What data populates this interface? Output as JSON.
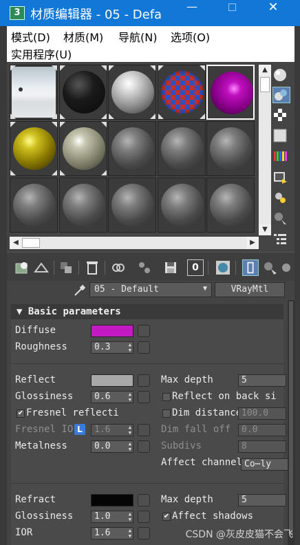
{
  "window": {
    "title": "材质编辑器 - 05 - Defa",
    "app_icon_glyph": "3",
    "min_glyph": "—",
    "close_glyph": "✕"
  },
  "menu": {
    "mode": "模式(D)",
    "material": "材质(M)",
    "navigation": "导航(N)",
    "options": "选项(O)",
    "utilities": "实用程序(U)"
  },
  "slots": [
    {
      "type": "sky"
    },
    {
      "type": "black"
    },
    {
      "type": "white"
    },
    {
      "type": "check"
    },
    {
      "type": "purple",
      "active": true
    },
    {
      "type": "yellow"
    },
    {
      "type": "olive"
    },
    {
      "type": "grey"
    },
    {
      "type": "grey"
    },
    {
      "type": "grey"
    },
    {
      "type": "grey"
    },
    {
      "type": "grey"
    },
    {
      "type": "grey"
    },
    {
      "type": "grey"
    },
    {
      "type": "grey"
    }
  ],
  "material": {
    "name": "05 - Default",
    "type": "VRayMtl"
  },
  "rollout": {
    "title": "Basic parameters",
    "collapse_glyph": "▼"
  },
  "params": {
    "diffuse_label": "Diffuse",
    "diffuse_color": "#c31ac3",
    "roughness_label": "Roughness",
    "roughness_value": "0.3",
    "reflect_label": "Reflect",
    "reflect_color": "#a8a8a8",
    "glossiness_label": "Glossiness",
    "glossiness_value": "0.6",
    "fresnel_label": "Fresnel reflecti",
    "fresnel_checked": "✔",
    "fresnel_ior_label": "Fresnel IO",
    "fresnel_ior_badge": "L",
    "fresnel_ior_value": "1.6",
    "metalness_label": "Metalness",
    "metalness_value": "0.0",
    "max_depth_label": "Max depth",
    "max_depth_value": "5",
    "reflect_back_label": "Reflect on back si",
    "dim_distance_label": "Dim distance",
    "dim_distance_value": "100.0",
    "dim_falloff_label": "Dim fall off",
    "dim_falloff_value": "0.0",
    "subdivs_label": "Subdivs",
    "subdivs_value": "8",
    "affect_channels_label": "Affect channel",
    "affect_channels_value": "Co⋯ly",
    "refract_label": "Refract",
    "refract_color": "#050505",
    "refr_glossiness_label": "Glossiness",
    "refr_glossiness_value": "1.0",
    "ior_label": "IOR",
    "ior_value": "1.6",
    "refr_max_depth_label": "Max depth",
    "refr_max_depth_value": "5",
    "affect_shadows_label": "Affect shadows",
    "affect_shadows_checked": "✔"
  },
  "watermark": "CSDN @灰皮皮猫不会飞"
}
